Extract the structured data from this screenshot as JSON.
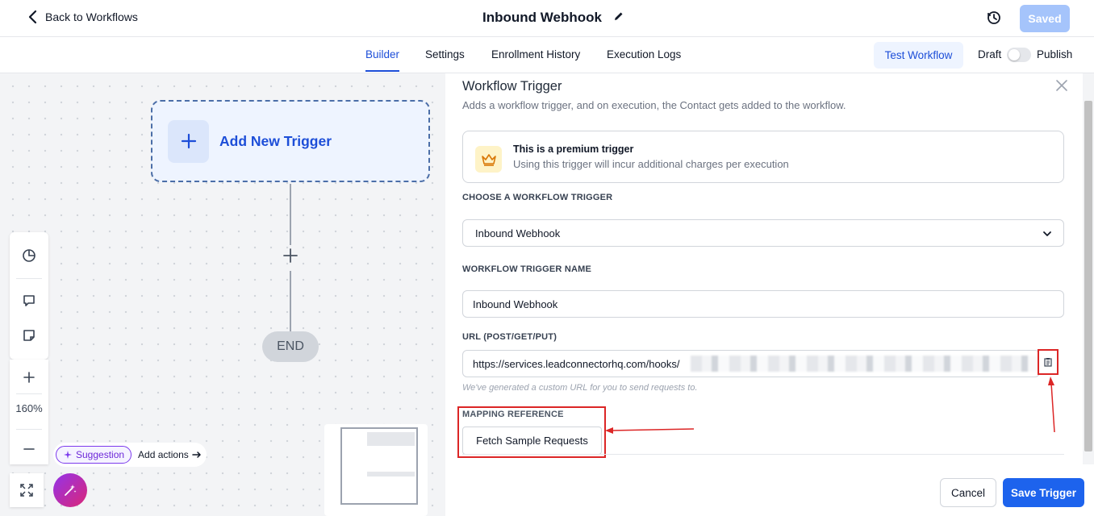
{
  "header": {
    "back_label": "Back to Workflows",
    "title": "Inbound Webhook",
    "saved_label": "Saved"
  },
  "tabs": [
    {
      "label": "Builder",
      "active": true
    },
    {
      "label": "Settings",
      "active": false
    },
    {
      "label": "Enrollment History",
      "active": false
    },
    {
      "label": "Execution Logs",
      "active": false
    }
  ],
  "toolbar": {
    "test_label": "Test Workflow",
    "draft_label": "Draft",
    "publish_label": "Publish",
    "publish_on": false
  },
  "canvas": {
    "trigger_label": "Add New Trigger",
    "end_label": "END",
    "zoom": "160%",
    "suggestion_label": "Suggestion",
    "add_actions_label": "Add actions"
  },
  "panel": {
    "title": "Workflow Trigger",
    "subtitle": "Adds a workflow trigger, and on execution, the Contact gets added to the workflow.",
    "premium_title": "This is a premium trigger",
    "premium_desc": "Using this trigger will incur additional charges per execution",
    "choose_label": "CHOOSE A WORKFLOW TRIGGER",
    "choose_value": "Inbound Webhook",
    "name_label": "WORKFLOW TRIGGER NAME",
    "name_value": "Inbound Webhook",
    "url_label": "URL (POST/GET/PUT)",
    "url_value": "https://services.leadconnectorhq.com/hooks/",
    "url_helper": "We've generated a custom URL for you to send requests to.",
    "mapping_label": "MAPPING REFERENCE",
    "fetch_label": "Fetch Sample Requests",
    "cancel_label": "Cancel",
    "save_label": "Save Trigger"
  },
  "colors": {
    "primary": "#1d63ed",
    "accent_text": "#1d4ed8",
    "annotation": "#dc2626"
  }
}
